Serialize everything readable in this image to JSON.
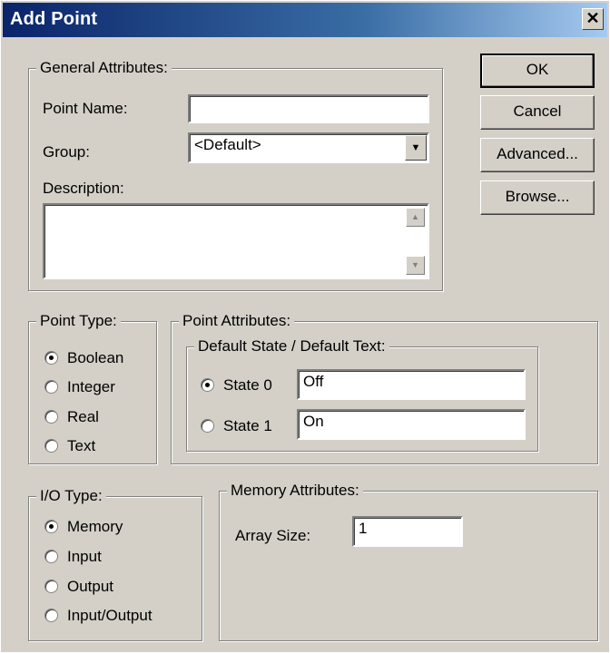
{
  "window": {
    "title": "Add Point",
    "close_symbol": "✕"
  },
  "general": {
    "legend": "General Attributes:",
    "point_name_label": "Point Name:",
    "point_name_value": "",
    "group_label": "Group:",
    "group_value": "<Default>",
    "description_label": "Description:",
    "description_value": ""
  },
  "buttons": {
    "ok": "OK",
    "cancel": "Cancel",
    "advanced": "Advanced...",
    "browse": "Browse..."
  },
  "point_type": {
    "legend": "Point Type:",
    "options": [
      "Boolean",
      "Integer",
      "Real",
      "Text"
    ],
    "selected": "Boolean"
  },
  "point_attributes": {
    "legend": "Point Attributes:",
    "default_legend": "Default State / Default Text:",
    "state0_label": "State 0",
    "state0_value": "Off",
    "state1_label": "State 1",
    "state1_value": "On",
    "selected": "State 0"
  },
  "io_type": {
    "legend": "I/O Type:",
    "options": [
      "Memory",
      "Input",
      "Output",
      "Input/Output"
    ],
    "selected": "Memory"
  },
  "memory": {
    "legend": "Memory Attributes:",
    "array_size_label": "Array Size:",
    "array_size_value": "1"
  },
  "icons": {
    "dropdown": "triangle-down-icon",
    "scroll_up": "arrow-up-icon",
    "scroll_down": "arrow-down-icon",
    "close": "close-icon"
  }
}
